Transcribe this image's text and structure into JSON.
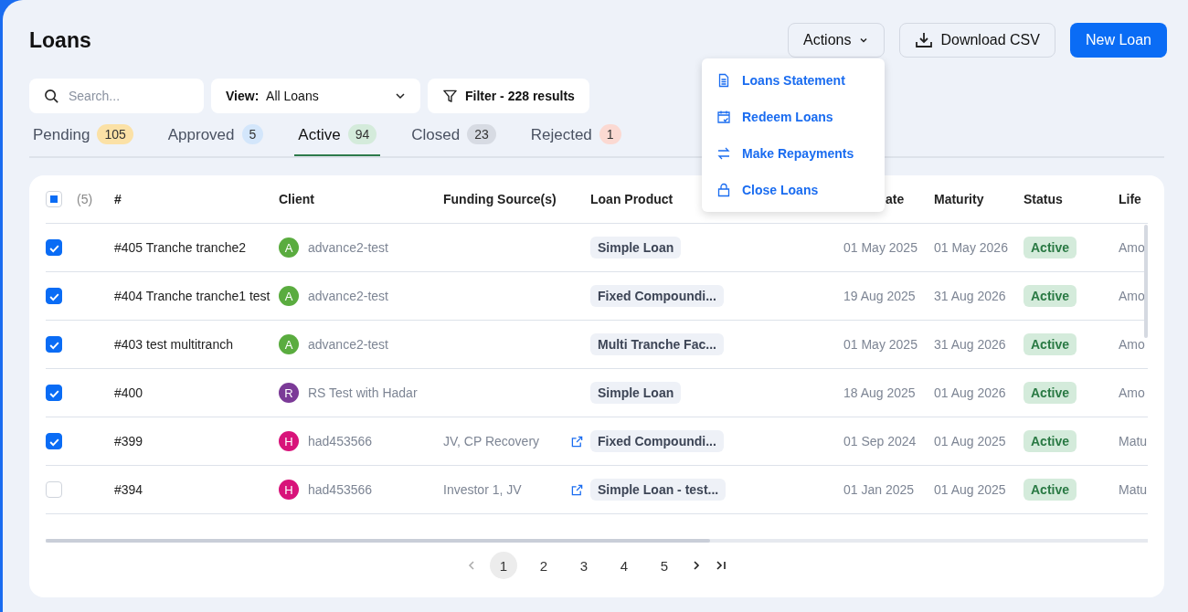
{
  "title": "Loans",
  "header_buttons": {
    "actions": "Actions",
    "download": "Download CSV",
    "new": "New Loan"
  },
  "actions_menu": [
    {
      "label": "Loans Statement",
      "kind": "document"
    },
    {
      "label": "Redeem Loans",
      "kind": "calendar"
    },
    {
      "label": "Make Repayments",
      "kind": "transfer"
    },
    {
      "label": "Close Loans",
      "kind": "lock"
    }
  ],
  "search": {
    "placeholder": "Search..."
  },
  "view": {
    "label": "View:",
    "value": "All Loans"
  },
  "filter": "Filter - 228 results",
  "tabs": [
    {
      "label": "Pending",
      "count": "105",
      "color": "#fbe1a6",
      "selected": false
    },
    {
      "label": "Approved",
      "count": "5",
      "color": "#d3e6fb",
      "selected": false
    },
    {
      "label": "Active",
      "count": "94",
      "color": "#d4ebdb",
      "selected": true
    },
    {
      "label": "Closed",
      "count": "23",
      "color": "#d7dbe3",
      "selected": false
    },
    {
      "label": "Rejected",
      "count": "1",
      "color": "#fbd9d2",
      "selected": false
    }
  ],
  "table": {
    "select_all": {
      "indeterminate": true,
      "count": "(5)"
    },
    "columns": [
      "#",
      "Client",
      "Funding Source(s)",
      "Loan Product",
      "",
      "ate",
      "Maturity",
      "Status",
      "Life"
    ],
    "rows": [
      {
        "checked": true,
        "id": "#405 Tranche tranche2",
        "initial": "A",
        "color": "#5aac3f",
        "client": "advance2-test",
        "funding": "",
        "product": "Simple Loan",
        "column_6": "",
        "start": "01 May 2025",
        "maturity": "01 May 2026",
        "status": "Active",
        "life": "Amo"
      },
      {
        "checked": true,
        "id": "#404 Tranche tranche1 test",
        "initial": "A",
        "color": "#5aac3f",
        "client": "advance2-test",
        "funding": "",
        "product": "Fixed Compoundi...",
        "column_6": "",
        "start": "19 Aug 2025",
        "maturity": "31 Aug 2026",
        "status": "Active",
        "life": "Amo"
      },
      {
        "checked": true,
        "id": "#403 test multitranch",
        "initial": "A",
        "color": "#5aac3f",
        "client": "advance2-test",
        "funding": "",
        "product": "Multi Tranche Fac...",
        "column_6": "",
        "start": "01 May 2025",
        "maturity": "31 Aug 2026",
        "status": "Active",
        "life": "Amo"
      },
      {
        "checked": true,
        "id": "#400",
        "initial": "R",
        "color": "#7b3a97",
        "client": "RS Test with Hadar",
        "funding": "",
        "product": "Simple Loan",
        "column_6": "",
        "start": "18 Aug 2025",
        "maturity": "01 Aug 2026",
        "status": "Active",
        "life": "Amo"
      },
      {
        "checked": true,
        "id": "#399",
        "initial": "H",
        "color": "#d8137a",
        "client": "had453566",
        "funding": "JV, CP Recovery",
        "product": "Fixed Compoundi...",
        "column_6": "",
        "start": "01 Sep 2024",
        "maturity": "01 Aug 2025",
        "status": "Active",
        "life": "Matu"
      },
      {
        "checked": false,
        "id": "#394",
        "initial": "H",
        "color": "#d8137a",
        "client": "had453566",
        "funding": "Investor 1, JV",
        "product": "Simple Loan - test...",
        "start": "01 Jan 2025",
        "maturity": "01 Aug 2025",
        "status": "Active",
        "life": "Matu"
      }
    ]
  },
  "pagination": {
    "pages": [
      {
        "label": "1",
        "selected": true
      },
      {
        "label": "2",
        "selected": false
      },
      {
        "label": "3",
        "selected": false
      },
      {
        "label": "4",
        "selected": false
      },
      {
        "label": "5",
        "selected": false
      }
    ]
  }
}
